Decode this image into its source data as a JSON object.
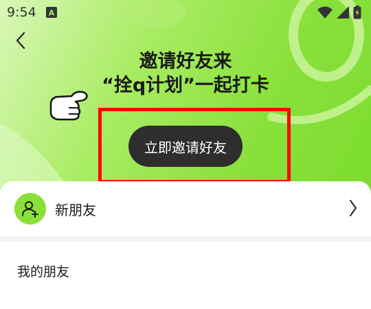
{
  "status_bar": {
    "time": "9:54",
    "notification_badge": "A",
    "icons": [
      "wifi-icon",
      "signal-icon",
      "battery-charging-icon"
    ]
  },
  "header": {
    "back_icon": "chevron-left-icon"
  },
  "hero": {
    "headline_line1": "邀请好友来",
    "headline_line2": "“拴q计划”一起打卡",
    "invite_button_label": "立即邀请好友",
    "pointer_icon": "pointing-hand-icon"
  },
  "new_friends": {
    "label": "新朋友",
    "icon": "add-user-icon"
  },
  "my_friends": {
    "title": "我的朋友"
  },
  "colors": {
    "accent_green": "#8be038",
    "button_dark": "#2e2e2e",
    "highlight_red": "#ff0000"
  }
}
